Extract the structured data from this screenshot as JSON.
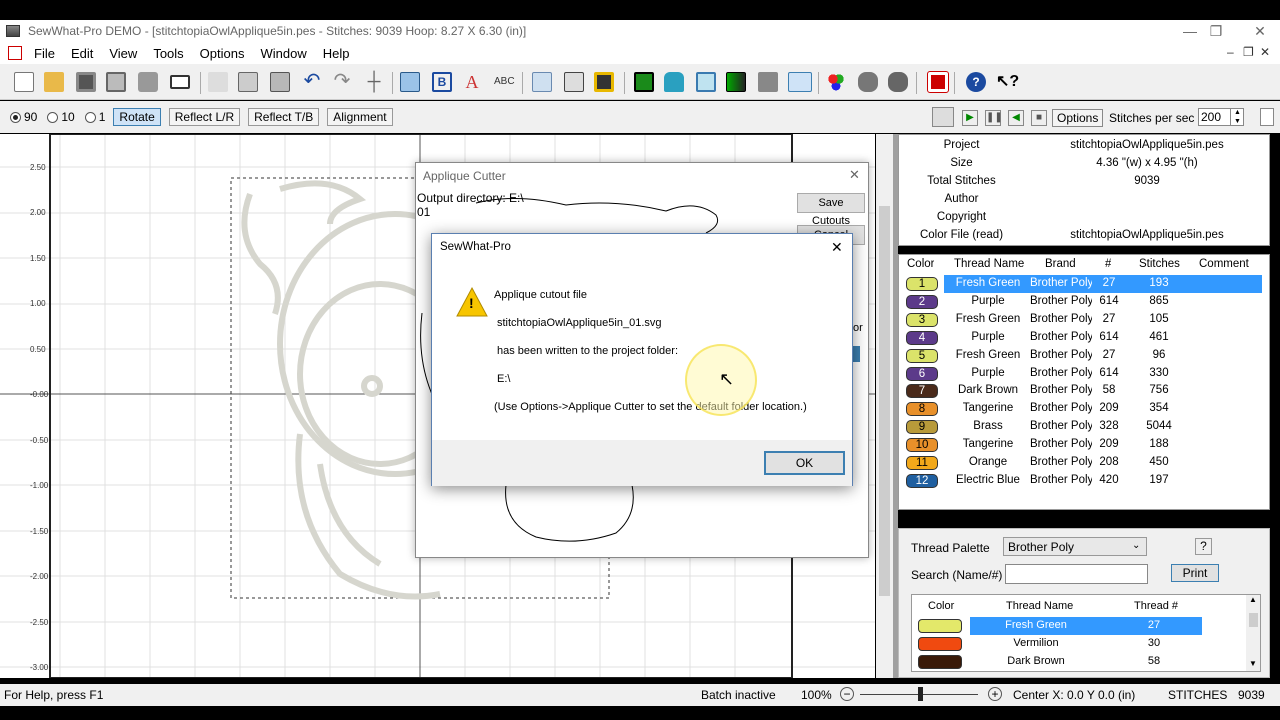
{
  "window": {
    "title": "SewWhat-Pro DEMO - [stitchtopiaOwlApplique5in.pes - Stitches: 9039  Hoop: 8.27 X 6.30 (in)]",
    "minimize": "—",
    "restore": "❐",
    "close": "✕"
  },
  "menu": {
    "items": [
      "File",
      "Edit",
      "View",
      "Tools",
      "Options",
      "Window",
      "Help"
    ],
    "mdi_min": "–",
    "mdi_restore": "❐",
    "mdi_close": "✕"
  },
  "options_bar": {
    "radio_90": "90",
    "radio_10": "10",
    "radio_1": "1",
    "rotate": "Rotate",
    "reflect_lr": "Reflect L/R",
    "reflect_tb": "Reflect T/B",
    "alignment": "Alignment"
  },
  "play_bar": {
    "options": "Options",
    "stitches_per_sec_label": "Stitches per sec",
    "stitches_per_sec_value": "200"
  },
  "canvas": {
    "y_ticks": [
      "2.50",
      "2.00",
      "1.50",
      "1.00",
      "0.50",
      "-0.00",
      "-0.50",
      "-1.00",
      "-1.50",
      "-2.00",
      "-2.50",
      "-3.00"
    ]
  },
  "properties": {
    "rows": [
      {
        "key": "Project",
        "value": "stitchtopiaOwlApplique5in.pes"
      },
      {
        "key": "Size",
        "value": "4.36 \"(w) x 4.95 \"(h)"
      },
      {
        "key": "Total Stitches",
        "value": "9039"
      },
      {
        "key": "Author",
        "value": ""
      },
      {
        "key": "Copyright",
        "value": ""
      },
      {
        "key": "Color File (read)",
        "value": "stitchtopiaOwlApplique5in.pes"
      }
    ]
  },
  "threads": {
    "headers": {
      "color": "Color",
      "name": "Thread Name",
      "brand": "Brand",
      "num": "#",
      "stitches": "Stitches",
      "comment": "Comment"
    },
    "rows": [
      {
        "idx": "1",
        "color": "#dbe36a",
        "name": "Fresh Green",
        "brand": "Brother Poly",
        "num": "27",
        "stitches": "193",
        "selected": true
      },
      {
        "idx": "2",
        "color": "#5c3a8a",
        "name": "Purple",
        "brand": "Brother Poly",
        "num": "614",
        "stitches": "865"
      },
      {
        "idx": "3",
        "color": "#dbe36a",
        "name": "Fresh Green",
        "brand": "Brother Poly",
        "num": "27",
        "stitches": "105"
      },
      {
        "idx": "4",
        "color": "#5c3a8a",
        "name": "Purple",
        "brand": "Brother Poly",
        "num": "614",
        "stitches": "461"
      },
      {
        "idx": "5",
        "color": "#dbe36a",
        "name": "Fresh Green",
        "brand": "Brother Poly",
        "num": "27",
        "stitches": "96"
      },
      {
        "idx": "6",
        "color": "#5c3a8a",
        "name": "Purple",
        "brand": "Brother Poly",
        "num": "614",
        "stitches": "330"
      },
      {
        "idx": "7",
        "color": "#4a2a1a",
        "name": "Dark Brown",
        "brand": "Brother Poly",
        "num": "58",
        "stitches": "756"
      },
      {
        "idx": "8",
        "color": "#e8902a",
        "name": "Tangerine",
        "brand": "Brother Poly",
        "num": "209",
        "stitches": "354"
      },
      {
        "idx": "9",
        "color": "#b89a3a",
        "name": "Brass",
        "brand": "Brother Poly",
        "num": "328",
        "stitches": "5044"
      },
      {
        "idx": "10",
        "color": "#e8902a",
        "name": "Tangerine",
        "brand": "Brother Poly",
        "num": "209",
        "stitches": "188"
      },
      {
        "idx": "11",
        "color": "#f2a81a",
        "name": "Orange",
        "brand": "Brother Poly",
        "num": "208",
        "stitches": "450"
      },
      {
        "idx": "12",
        "color": "#1f5fa0",
        "name": "Electric Blue",
        "brand": "Brother Poly",
        "num": "420",
        "stitches": "197"
      }
    ]
  },
  "palette": {
    "label": "Thread Palette",
    "value": "Brother Poly",
    "help": "?",
    "search_label": "Search (Name/#)",
    "search_value": "",
    "print": "Print",
    "headers": {
      "color": "Color",
      "name": "Thread Name",
      "num": "Thread #"
    },
    "rows": [
      {
        "color": "#e3e86a",
        "name": "Fresh Green",
        "num": "27",
        "selected": true
      },
      {
        "color": "#f04a10",
        "name": "Vermilion",
        "num": "30"
      },
      {
        "color": "#3a1a08",
        "name": "Dark Brown",
        "num": "58"
      }
    ]
  },
  "status": {
    "help": "For Help, press F1",
    "batch": "Batch inactive",
    "zoom": "100%",
    "center": "Center X: 0.0  Y 0.0 (in)",
    "stitches_label": "STITCHES",
    "stitches_value": "9039"
  },
  "applique_dialog": {
    "title": "Applique Cutter",
    "output_dir": "Output directory: E:\\",
    "suffix": "01",
    "save_cutouts": "Save Cutouts",
    "cancel_fragment": "Cancel",
    "side_fragment": "tor"
  },
  "message_box": {
    "title": "SewWhat-Pro",
    "line1": "Applique cutout file",
    "line2": "stitchtopiaOwlApplique5in_01.svg",
    "line3": "has been written to the project folder:",
    "line4": "E:\\",
    "line5": "(Use Options->Applique Cutter to set the default folder location.)",
    "ok": "OK",
    "warning_glyph": "!"
  },
  "colors": {
    "selection": "#3399ff",
    "warning": "#f7c500"
  }
}
